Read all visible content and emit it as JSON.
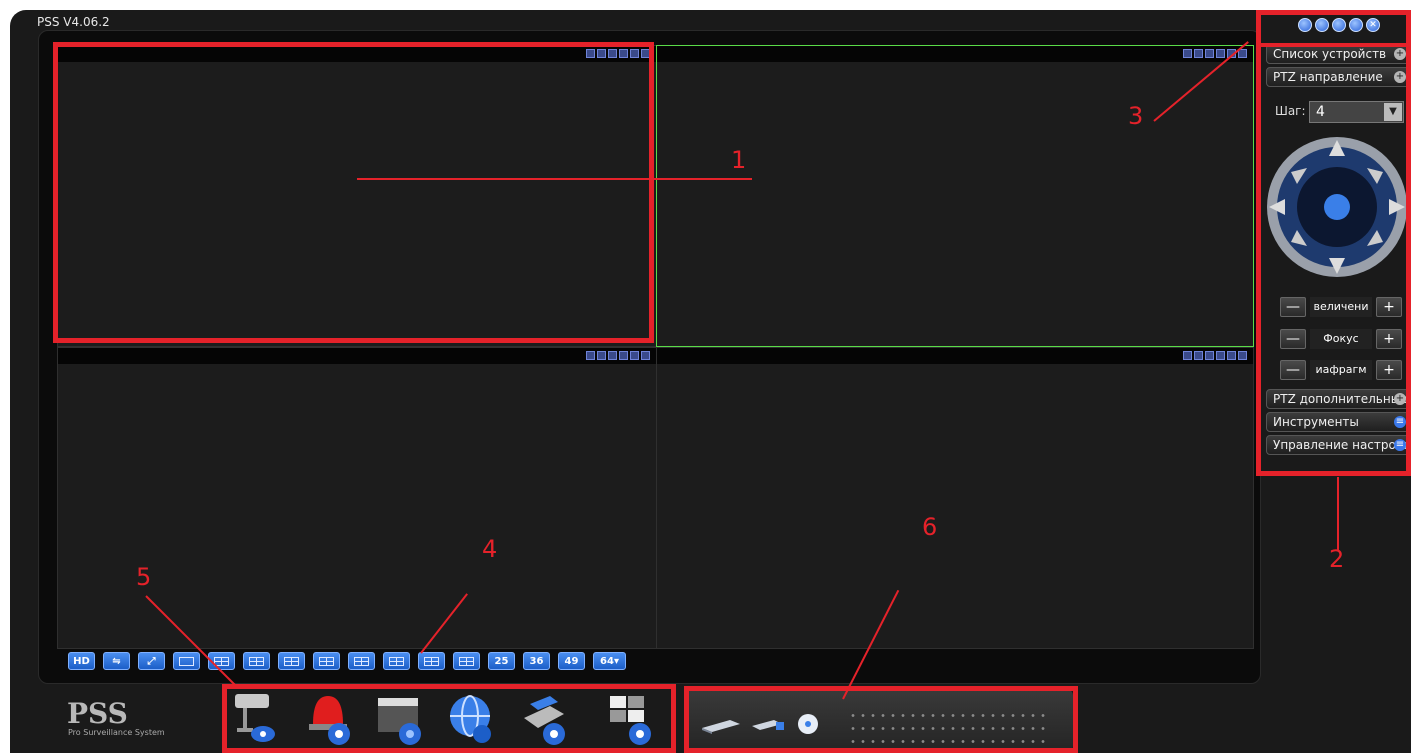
{
  "window": {
    "title": "PSS V4.06.2"
  },
  "side_panel": {
    "device_list": "Список устройств",
    "ptz_direction": "PTZ направление",
    "step_label": "Шаг:",
    "step_value": "4",
    "zoom_label": "величени",
    "focus_label": "Фокус",
    "iris_label": "иафрагм",
    "ptz_extra": "PTZ дополнительные",
    "tools": "Инструменты",
    "settings": "Управление настройками"
  },
  "layout_bar": {
    "hd": "HD",
    "n25": "25",
    "n36": "36",
    "n49": "49",
    "n64": "64▾"
  },
  "logo": {
    "title": "PSS",
    "subtitle": "Pro Surveillance System"
  },
  "annotations": {
    "a1": "1",
    "a2": "2",
    "a3": "3",
    "a4": "4",
    "a5": "5",
    "a6": "6"
  },
  "colors": {
    "annotation": "#e5222a",
    "active_pane": "#5adc48",
    "accent": "#2a62d8"
  },
  "icons": [
    "camera-eye-icon",
    "alarm-siren-icon",
    "clapper-record-icon",
    "globe-web-icon",
    "device-config-icon",
    "tv-wall-icon",
    "hdd-icon",
    "disk-icon",
    "cd-icon"
  ]
}
